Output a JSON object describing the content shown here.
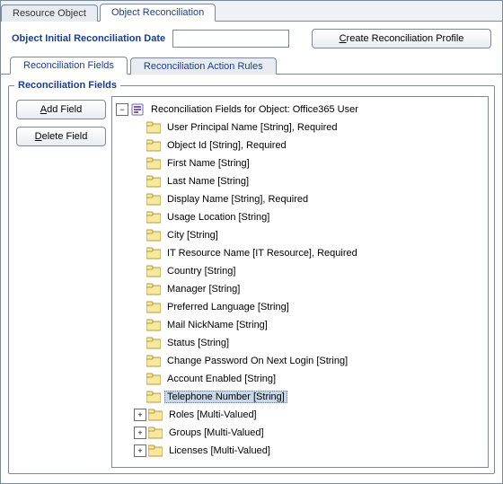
{
  "topTabs": {
    "resourceObject": "Resource Object",
    "objectReconciliation": "Object Reconciliation"
  },
  "header": {
    "dateLabel": "Object Initial Reconciliation Date",
    "dateValue": "",
    "createProfileBtn_pre": "",
    "createProfileBtn_m": "C",
    "createProfileBtn_post": "reate Reconciliation Profile"
  },
  "innerTabs": {
    "fields": "Reconciliation Fields",
    "actionRules": "Reconciliation Action Rules"
  },
  "panel": {
    "legend": "Reconciliation Fields",
    "addBtn_m": "A",
    "addBtn_post": "dd Field",
    "delBtn_m": "D",
    "delBtn_post": "elete Field"
  },
  "tree": {
    "rootLabel": "Reconciliation Fields for Object: Office365 User",
    "items": [
      {
        "label": "User Principal Name [String], Required",
        "expandable": false
      },
      {
        "label": "Object Id [String], Required",
        "expandable": false
      },
      {
        "label": "First Name [String]",
        "expandable": false
      },
      {
        "label": "Last Name [String]",
        "expandable": false
      },
      {
        "label": "Display Name [String], Required",
        "expandable": false
      },
      {
        "label": "Usage Location [String]",
        "expandable": false
      },
      {
        "label": "City [String]",
        "expandable": false
      },
      {
        "label": "IT Resource Name [IT Resource], Required",
        "expandable": false
      },
      {
        "label": "Country [String]",
        "expandable": false
      },
      {
        "label": "Manager [String]",
        "expandable": false
      },
      {
        "label": "Preferred Language [String]",
        "expandable": false
      },
      {
        "label": "Mail NickName [String]",
        "expandable": false
      },
      {
        "label": "Status [String]",
        "expandable": false
      },
      {
        "label": "Change Password On Next Login [String]",
        "expandable": false
      },
      {
        "label": "Account Enabled [String]",
        "expandable": false
      },
      {
        "label": "Telephone Number [String]",
        "expandable": false,
        "selected": true
      },
      {
        "label": "Roles [Multi-Valued]",
        "expandable": true
      },
      {
        "label": "Groups [Multi-Valued]",
        "expandable": true
      },
      {
        "label": "Licenses [Multi-Valued]",
        "expandable": true
      }
    ]
  },
  "glyphs": {
    "plus": "+",
    "minus": "−"
  }
}
